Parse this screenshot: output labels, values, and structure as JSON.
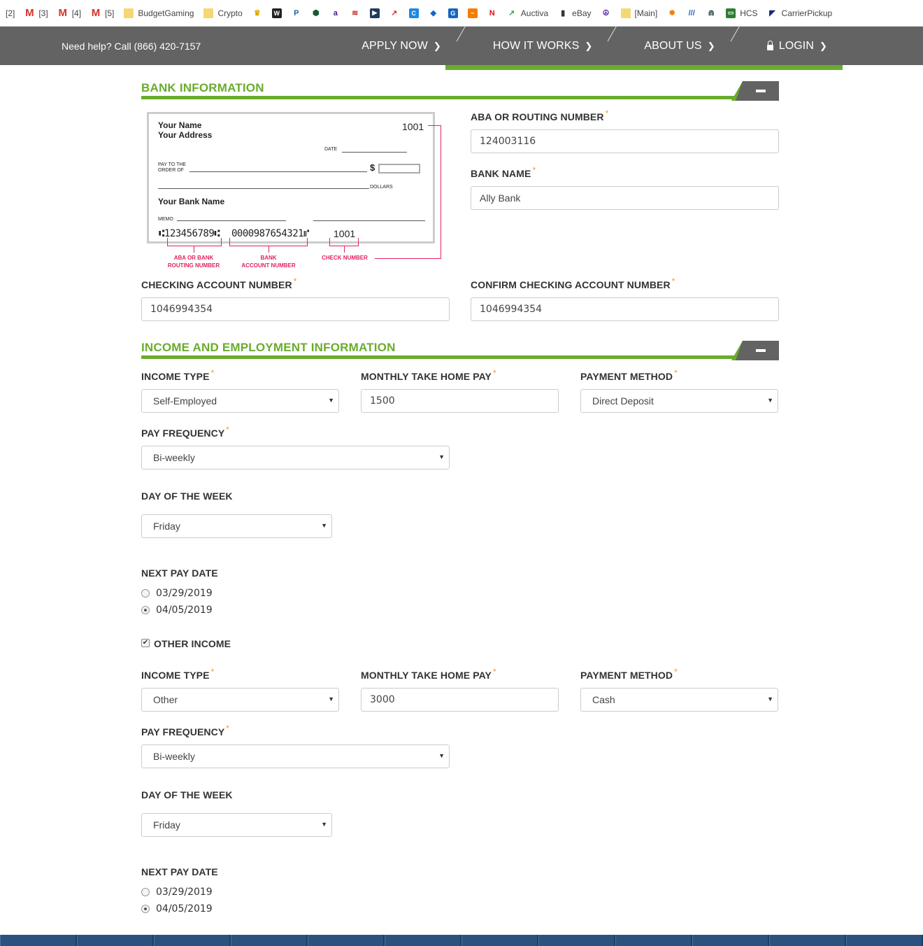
{
  "bookmarks": [
    "[2]",
    "[3]",
    "[4]",
    "[5]",
    "BudgetGaming",
    "Crypto",
    "Auctiva",
    "eBay",
    "[Main]",
    "HCS",
    "CarrierPickup"
  ],
  "header": {
    "help_text": "Need help? Call (866) 420-7157",
    "nav": [
      "APPLY NOW",
      "HOW IT WORKS",
      "ABOUT US",
      "LOGIN"
    ]
  },
  "bank": {
    "section_title": "BANK INFORMATION",
    "check": {
      "name": "Your Name",
      "address": "Your Address",
      "check_no": "1001",
      "date": "DATE",
      "pay_to": "PAY TO THE",
      "order_of": "ORDER OF",
      "dollar": "$",
      "dollars": "DOLLARS",
      "bank_name": "Your Bank Name",
      "memo": "MEMO",
      "micr_routing": "⑆123456789⑆",
      "micr_account": "0000987654321⑈",
      "micr_check": "1001",
      "lbl_routing_1": "ABA OR BANK",
      "lbl_routing_2": "ROUTING NUMBER",
      "lbl_account_1": "BANK",
      "lbl_account_2": "ACCOUNT NUMBER",
      "lbl_check": "CHECK NUMBER"
    },
    "routing_label": "ABA OR ROUTING NUMBER",
    "routing_value": "124003116",
    "bankname_label": "BANK NAME",
    "bankname_value": "Ally Bank",
    "acct_label": "CHECKING ACCOUNT NUMBER",
    "acct_value": "1046994354",
    "confirm_label": "CONFIRM CHECKING ACCOUNT NUMBER",
    "confirm_value": "1046994354"
  },
  "income": {
    "section_title": "INCOME AND EMPLOYMENT INFORMATION",
    "primary": {
      "type_label": "INCOME TYPE",
      "type_value": "Self-Employed",
      "pay_label": "MONTHLY TAKE HOME PAY",
      "pay_value": "1500",
      "method_label": "PAYMENT METHOD",
      "method_value": "Direct Deposit",
      "freq_label": "PAY FREQUENCY",
      "freq_value": "Bi-weekly",
      "dow_label": "DAY OF THE WEEK",
      "dow_value": "Friday",
      "next_label": "NEXT PAY DATE",
      "dates": [
        "03/29/2019",
        "04/05/2019"
      ]
    },
    "other_income_label": "OTHER INCOME",
    "other_income_checked": true,
    "secondary": {
      "type_label": "INCOME TYPE",
      "type_value": "Other",
      "pay_label": "MONTHLY TAKE HOME PAY",
      "pay_value": "3000",
      "method_label": "PAYMENT METHOD",
      "method_value": "Cash",
      "freq_label": "PAY FREQUENCY",
      "freq_value": "Bi-weekly",
      "dow_label": "DAY OF THE WEEK",
      "dow_value": "Friday",
      "next_label": "NEXT PAY DATE",
      "dates": [
        "03/29/2019",
        "04/05/2019"
      ]
    }
  },
  "colors": {
    "accent": "#6aac2c",
    "header": "#636363",
    "required": "#f39c2c",
    "check_callout": "#e0245e"
  }
}
